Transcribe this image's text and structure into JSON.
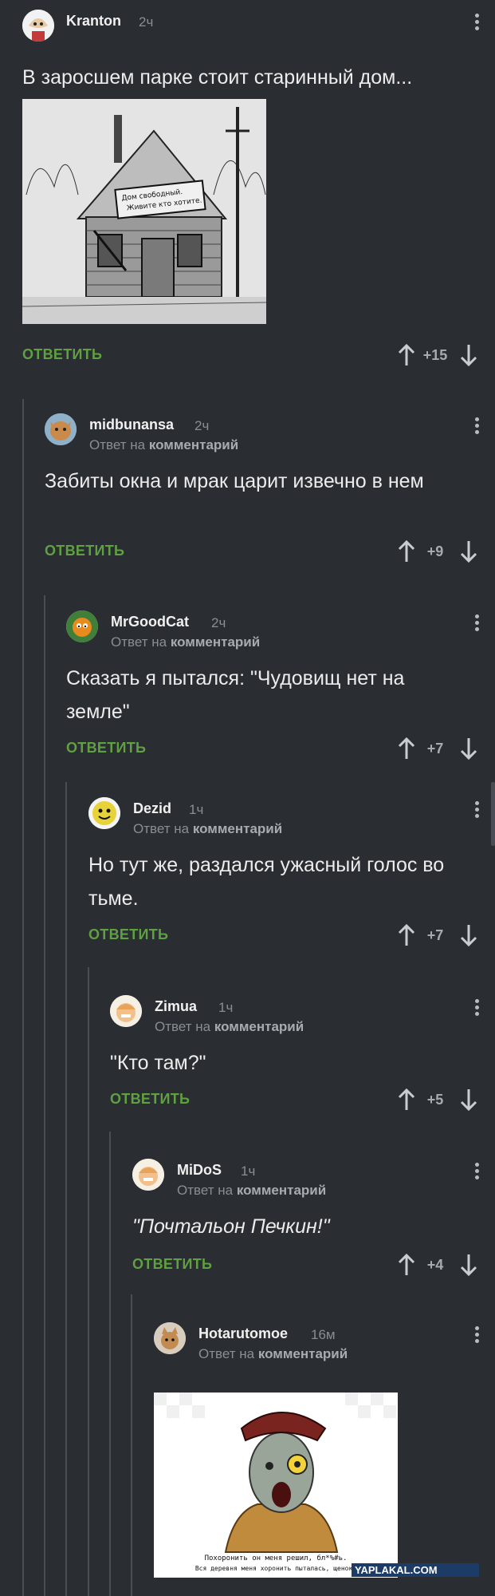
{
  "reply_label": "ОТВЕТИТЬ",
  "reply_to_prefix": "Ответ на",
  "reply_to_link": "комментарий",
  "comments": [
    {
      "author": "Kranton",
      "time": "2ч",
      "text": "В заросшем парке стоит старинный дом...",
      "score": "+15"
    },
    {
      "author": "midbunansa",
      "time": "2ч",
      "text": "Забиты окна и мрак царит извечно в нем",
      "score": "+9"
    },
    {
      "author": "MrGoodCat",
      "time": "2ч",
      "text": "Сказать я пытался: \"Чудовищ нет на земле\"",
      "score": "+7"
    },
    {
      "author": "Dezid",
      "time": "1ч",
      "text": "Но тут же, раздался ужасный голос во тьме.",
      "score": "+7"
    },
    {
      "author": "Zimua",
      "time": "1ч",
      "text": "\"Кто там?\"",
      "score": "+5"
    },
    {
      "author": "MiDoS",
      "time": "1ч",
      "text": "\"Почтальон Печкин!\"",
      "score": "+4"
    },
    {
      "author": "Hotarutomoe",
      "time": "16м",
      "text": "",
      "score": ""
    }
  ],
  "images": {
    "house_sign": "Дом свободный. Живите кто хотите.",
    "pechkin_caption": "Похоронить он меня решил, бл*%#ь. Вся деревня меня хоронить пыталась, щенок!",
    "watermark": "YAPLAKAL.COM"
  },
  "colors": {
    "background": "#2a2d31",
    "accent": "#5fa042",
    "muted": "#8a8d92"
  }
}
